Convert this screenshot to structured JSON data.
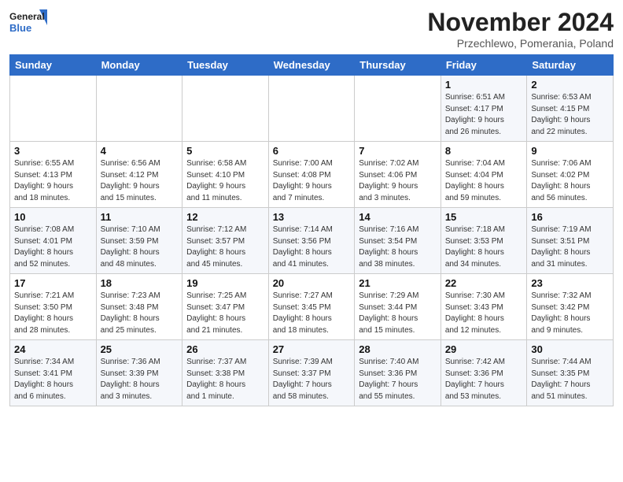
{
  "logo": {
    "text_general": "General",
    "text_blue": "Blue"
  },
  "header": {
    "month_year": "November 2024",
    "location": "Przechlewo, Pomerania, Poland"
  },
  "days_of_week": [
    "Sunday",
    "Monday",
    "Tuesday",
    "Wednesday",
    "Thursday",
    "Friday",
    "Saturday"
  ],
  "weeks": [
    [
      {
        "day": "",
        "info": ""
      },
      {
        "day": "",
        "info": ""
      },
      {
        "day": "",
        "info": ""
      },
      {
        "day": "",
        "info": ""
      },
      {
        "day": "",
        "info": ""
      },
      {
        "day": "1",
        "info": "Sunrise: 6:51 AM\nSunset: 4:17 PM\nDaylight: 9 hours\nand 26 minutes."
      },
      {
        "day": "2",
        "info": "Sunrise: 6:53 AM\nSunset: 4:15 PM\nDaylight: 9 hours\nand 22 minutes."
      }
    ],
    [
      {
        "day": "3",
        "info": "Sunrise: 6:55 AM\nSunset: 4:13 PM\nDaylight: 9 hours\nand 18 minutes."
      },
      {
        "day": "4",
        "info": "Sunrise: 6:56 AM\nSunset: 4:12 PM\nDaylight: 9 hours\nand 15 minutes."
      },
      {
        "day": "5",
        "info": "Sunrise: 6:58 AM\nSunset: 4:10 PM\nDaylight: 9 hours\nand 11 minutes."
      },
      {
        "day": "6",
        "info": "Sunrise: 7:00 AM\nSunset: 4:08 PM\nDaylight: 9 hours\nand 7 minutes."
      },
      {
        "day": "7",
        "info": "Sunrise: 7:02 AM\nSunset: 4:06 PM\nDaylight: 9 hours\nand 3 minutes."
      },
      {
        "day": "8",
        "info": "Sunrise: 7:04 AM\nSunset: 4:04 PM\nDaylight: 8 hours\nand 59 minutes."
      },
      {
        "day": "9",
        "info": "Sunrise: 7:06 AM\nSunset: 4:02 PM\nDaylight: 8 hours\nand 56 minutes."
      }
    ],
    [
      {
        "day": "10",
        "info": "Sunrise: 7:08 AM\nSunset: 4:01 PM\nDaylight: 8 hours\nand 52 minutes."
      },
      {
        "day": "11",
        "info": "Sunrise: 7:10 AM\nSunset: 3:59 PM\nDaylight: 8 hours\nand 48 minutes."
      },
      {
        "day": "12",
        "info": "Sunrise: 7:12 AM\nSunset: 3:57 PM\nDaylight: 8 hours\nand 45 minutes."
      },
      {
        "day": "13",
        "info": "Sunrise: 7:14 AM\nSunset: 3:56 PM\nDaylight: 8 hours\nand 41 minutes."
      },
      {
        "day": "14",
        "info": "Sunrise: 7:16 AM\nSunset: 3:54 PM\nDaylight: 8 hours\nand 38 minutes."
      },
      {
        "day": "15",
        "info": "Sunrise: 7:18 AM\nSunset: 3:53 PM\nDaylight: 8 hours\nand 34 minutes."
      },
      {
        "day": "16",
        "info": "Sunrise: 7:19 AM\nSunset: 3:51 PM\nDaylight: 8 hours\nand 31 minutes."
      }
    ],
    [
      {
        "day": "17",
        "info": "Sunrise: 7:21 AM\nSunset: 3:50 PM\nDaylight: 8 hours\nand 28 minutes."
      },
      {
        "day": "18",
        "info": "Sunrise: 7:23 AM\nSunset: 3:48 PM\nDaylight: 8 hours\nand 25 minutes."
      },
      {
        "day": "19",
        "info": "Sunrise: 7:25 AM\nSunset: 3:47 PM\nDaylight: 8 hours\nand 21 minutes."
      },
      {
        "day": "20",
        "info": "Sunrise: 7:27 AM\nSunset: 3:45 PM\nDaylight: 8 hours\nand 18 minutes."
      },
      {
        "day": "21",
        "info": "Sunrise: 7:29 AM\nSunset: 3:44 PM\nDaylight: 8 hours\nand 15 minutes."
      },
      {
        "day": "22",
        "info": "Sunrise: 7:30 AM\nSunset: 3:43 PM\nDaylight: 8 hours\nand 12 minutes."
      },
      {
        "day": "23",
        "info": "Sunrise: 7:32 AM\nSunset: 3:42 PM\nDaylight: 8 hours\nand 9 minutes."
      }
    ],
    [
      {
        "day": "24",
        "info": "Sunrise: 7:34 AM\nSunset: 3:41 PM\nDaylight: 8 hours\nand 6 minutes."
      },
      {
        "day": "25",
        "info": "Sunrise: 7:36 AM\nSunset: 3:39 PM\nDaylight: 8 hours\nand 3 minutes."
      },
      {
        "day": "26",
        "info": "Sunrise: 7:37 AM\nSunset: 3:38 PM\nDaylight: 8 hours\nand 1 minute."
      },
      {
        "day": "27",
        "info": "Sunrise: 7:39 AM\nSunset: 3:37 PM\nDaylight: 7 hours\nand 58 minutes."
      },
      {
        "day": "28",
        "info": "Sunrise: 7:40 AM\nSunset: 3:36 PM\nDaylight: 7 hours\nand 55 minutes."
      },
      {
        "day": "29",
        "info": "Sunrise: 7:42 AM\nSunset: 3:36 PM\nDaylight: 7 hours\nand 53 minutes."
      },
      {
        "day": "30",
        "info": "Sunrise: 7:44 AM\nSunset: 3:35 PM\nDaylight: 7 hours\nand 51 minutes."
      }
    ]
  ]
}
